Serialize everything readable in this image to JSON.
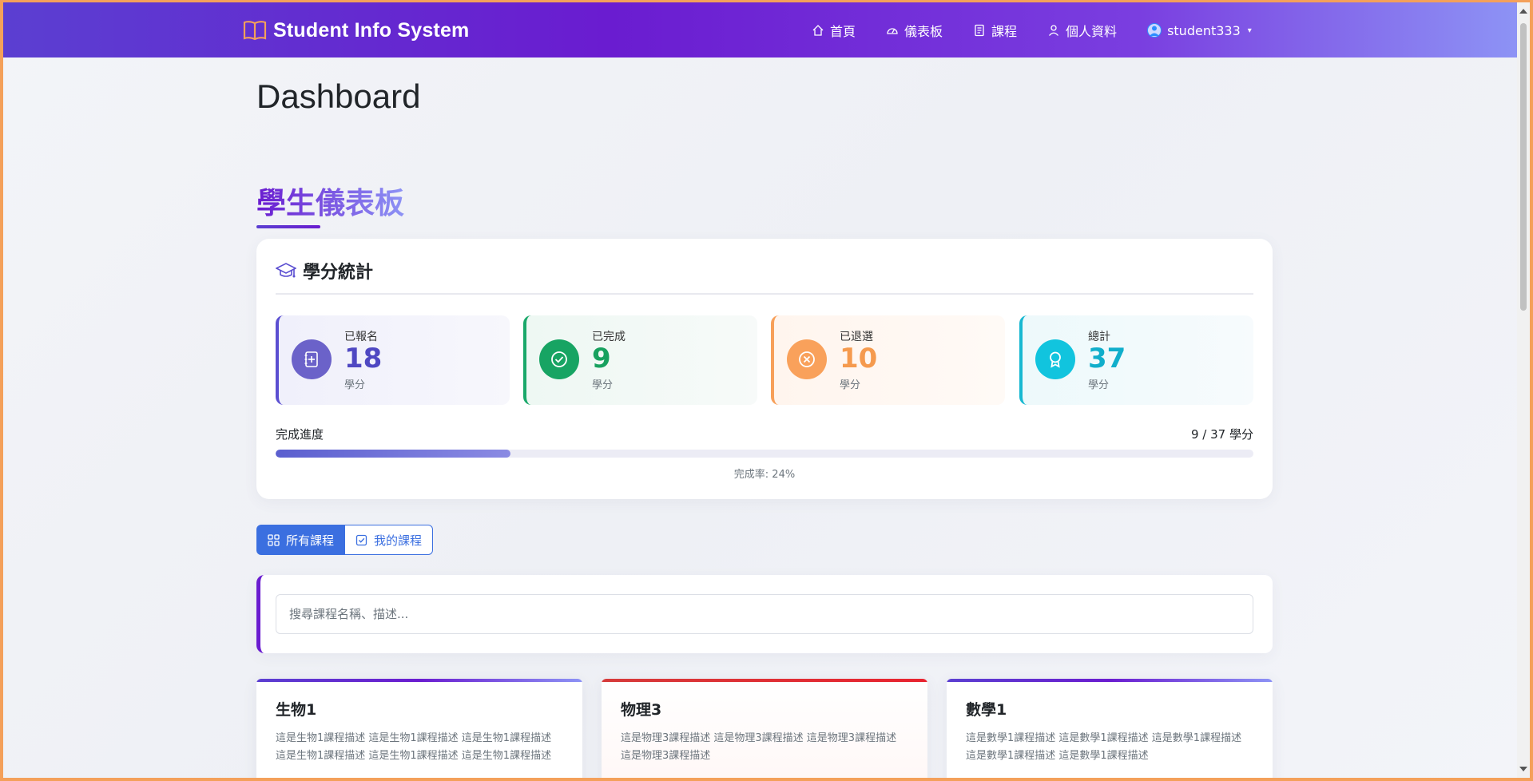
{
  "navbar": {
    "brand": "Student Info System",
    "items": [
      {
        "label": "首頁",
        "icon": "home-icon"
      },
      {
        "label": "儀表板",
        "icon": "speedometer-icon"
      },
      {
        "label": "課程",
        "icon": "journal-icon"
      },
      {
        "label": "個人資料",
        "icon": "person-icon"
      }
    ],
    "user": "student333"
  },
  "page_title": "Dashboard",
  "section_title": "學生儀表板",
  "credits": {
    "header": "學分統計",
    "stats": [
      {
        "label": "已報名",
        "value": "18",
        "unit": "學分",
        "color": "#4f48c2"
      },
      {
        "label": "已完成",
        "value": "9",
        "unit": "學分",
        "color": "#18a15f"
      },
      {
        "label": "已退選",
        "value": "10",
        "unit": "學分",
        "color": "#f59a4e"
      },
      {
        "label": "總計",
        "value": "37",
        "unit": "學分",
        "color": "#10aecb"
      }
    ],
    "progress_label": "完成進度",
    "progress_count": "9 / 37 學分",
    "progress_fraction": 0.24,
    "progress_rate": "完成率: 24%"
  },
  "tabs": {
    "all": "所有課程",
    "mine": "我的課程"
  },
  "search": {
    "placeholder": "搜尋課程名稱、描述..."
  },
  "courses": [
    {
      "name": "生物1",
      "desc": "這是生物1課程描述 這是生物1課程描述 這是生物1課程描述 這是生物1課程描述 這是生物1課程描述 這是生物1課程描述"
    },
    {
      "name": "物理3",
      "desc": "這是物理3課程描述 這是物理3課程描述 這是物理3課程描述 這是物理3課程描述"
    },
    {
      "name": "數學1",
      "desc": "這是數學1課程描述 這是數學1課程描述 這是數學1課程描述 這是數學1課程描述 這是數學1課程描述"
    }
  ]
}
